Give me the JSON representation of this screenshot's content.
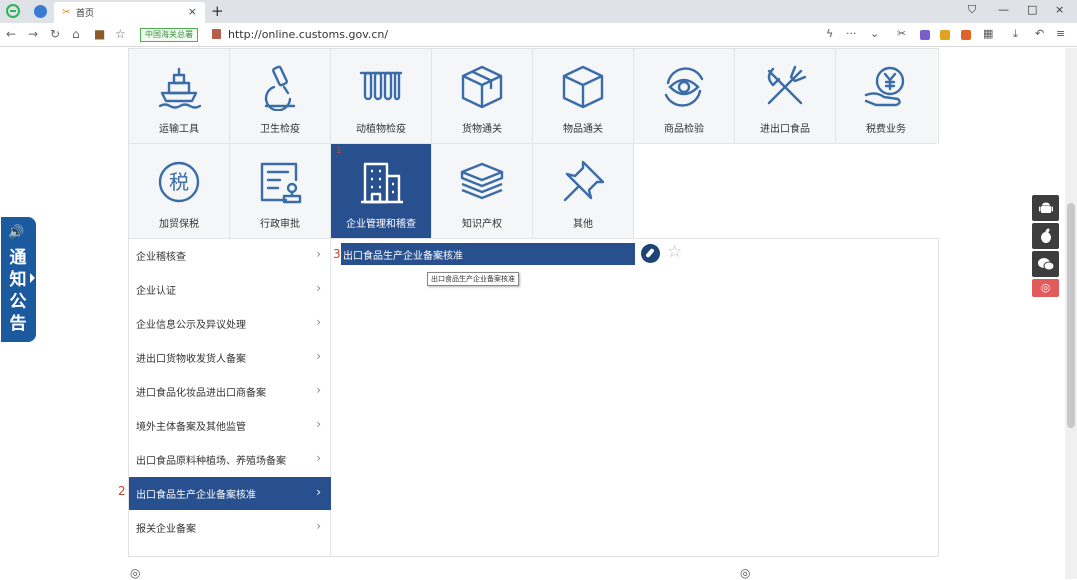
{
  "browser": {
    "tab_title": "首页",
    "tab_close": "×",
    "new_tab": "+",
    "window_controls": [
      "—",
      "□",
      "×"
    ],
    "site_badge": "中国海关总署",
    "url": "http://online.customs.gov.cn/",
    "menu_dots": "···"
  },
  "notice": {
    "label": "通知公告"
  },
  "grid": [
    {
      "label": "运输工具",
      "icon": "ship-icon"
    },
    {
      "label": "卫生检疫",
      "icon": "microscope-icon"
    },
    {
      "label": "动植物检疫",
      "icon": "plant-tubes-icon"
    },
    {
      "label": "货物通关",
      "icon": "box-icon"
    },
    {
      "label": "物品通关",
      "icon": "cube-icon"
    },
    {
      "label": "商品检验",
      "icon": "eye-icon"
    },
    {
      "label": "进出口食品",
      "icon": "fork-knife-icon"
    },
    {
      "label": "税费业务",
      "icon": "tax-hand-icon"
    },
    {
      "label": "加贸保税",
      "icon": "tax-circle-icon"
    },
    {
      "label": "行政审批",
      "icon": "approval-icon"
    },
    {
      "label": "企业管理和稽查",
      "icon": "building-icon",
      "active": true
    },
    {
      "label": "知识产权",
      "icon": "books-icon"
    },
    {
      "label": "其他",
      "icon": "pin-icon"
    }
  ],
  "menu": [
    "企业稽核查",
    "企业认证",
    "企业信息公示及异议处理",
    "进出口货物收发货人备案",
    "进口食品化妆品进出口商备案",
    "境外主体备案及其他监管",
    "出口食品原料种植场、养殖场备案",
    "出口食品生产企业备案核准",
    "报关企业备案"
  ],
  "menu_active_index": 7,
  "sub": {
    "item": "出口食品生产企业备案核准",
    "tooltip": "出口食品生产企业备案核准"
  },
  "steps": {
    "one": "1",
    "two": "2",
    "three": "3"
  },
  "side_buttons": [
    {
      "name": "android-icon",
      "glyph": "▮"
    },
    {
      "name": "apple-icon",
      "glyph": "●"
    },
    {
      "name": "wechat-icon",
      "glyph": "◍"
    },
    {
      "name": "top-icon",
      "glyph": "◎"
    }
  ],
  "colors": {
    "primary": "#28508f",
    "notice": "#1c5aa0",
    "step": "#c4442f",
    "icon_stroke": "#3a6ca8"
  }
}
